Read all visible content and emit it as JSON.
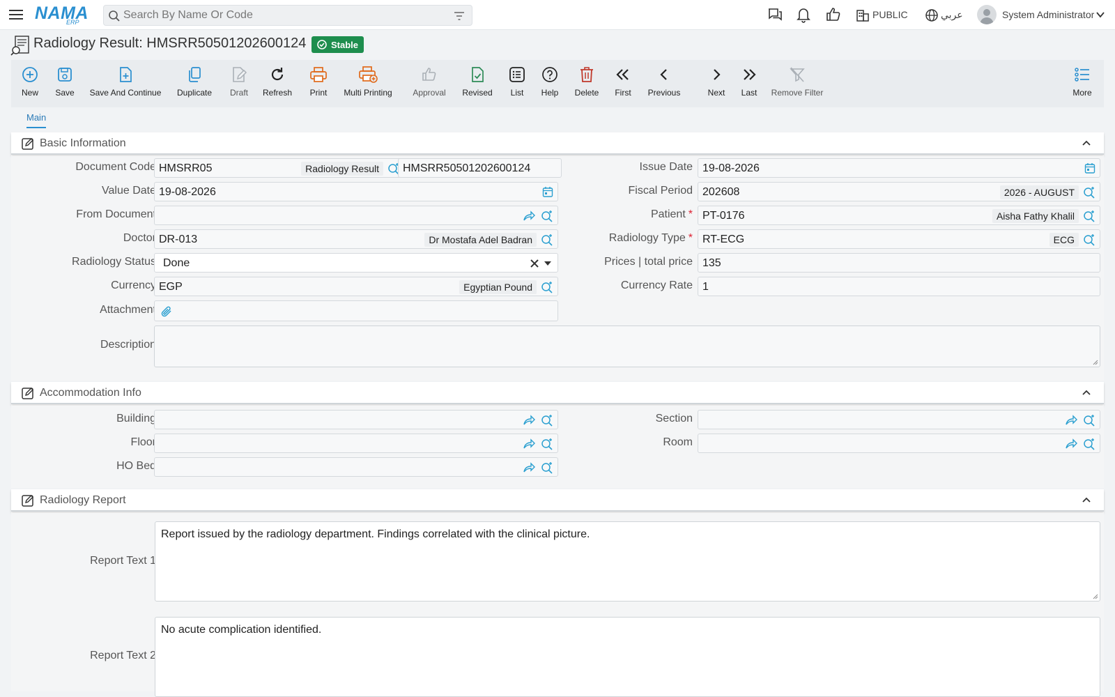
{
  "header": {
    "logo": "NAMA",
    "logo_sub": "ERP",
    "search_placeholder": "Search By Name Or Code",
    "branch": "PUBLIC",
    "language": "عربي",
    "user": "System Administrator"
  },
  "page": {
    "title": "Radiology Result: HMSRR50501202600124",
    "status": "Stable"
  },
  "toolbar": {
    "new": "New",
    "save": "Save",
    "save_continue": "Save And Continue",
    "duplicate": "Duplicate",
    "draft": "Draft",
    "refresh": "Refresh",
    "print": "Print",
    "multi_printing": "Multi Printing",
    "approval": "Approval",
    "revised": "Revised",
    "list": "List",
    "help": "Help",
    "delete": "Delete",
    "first": "First",
    "previous": "Previous",
    "next": "Next",
    "last": "Last",
    "remove_filter": "Remove Filter",
    "more": "More"
  },
  "tabs": {
    "main": "Main"
  },
  "basic": {
    "title": "Basic Information",
    "document_code": {
      "label": "Document Code",
      "value": "HMSRR05",
      "desc": "Radiology Result",
      "code": "HMSRR50501202600124"
    },
    "issue_date": {
      "label": "Issue Date",
      "value": "19-08-2026"
    },
    "value_date": {
      "label": "Value Date",
      "value": "19-08-2026"
    },
    "fiscal_period": {
      "label": "Fiscal Period",
      "value": "202608",
      "desc": "2026 - AUGUST"
    },
    "from_document": {
      "label": "From Document",
      "value": ""
    },
    "patient": {
      "label": "Patient",
      "value": "PT-0176",
      "desc": "Aisha Fathy Khalil"
    },
    "doctor": {
      "label": "Doctor",
      "value": "DR-013",
      "desc": "Dr Mostafa Adel Badran"
    },
    "radiology_type": {
      "label": "Radiology Type",
      "value": "RT-ECG",
      "desc": "ECG"
    },
    "radiology_status": {
      "label": "Radiology Status",
      "value": "Done"
    },
    "prices": {
      "label": "Prices | total price",
      "value": "135"
    },
    "currency": {
      "label": "Currency",
      "value": "EGP",
      "desc": "Egyptian Pound"
    },
    "currency_rate": {
      "label": "Currency Rate",
      "value": "1"
    },
    "attachment": {
      "label": "Attachment"
    },
    "description": {
      "label": "Description",
      "value": ""
    }
  },
  "accommodation": {
    "title": "Accommodation Info",
    "building": "Building",
    "section": "Section",
    "floor": "Floor",
    "room": "Room",
    "ho_bed": "HO Bed"
  },
  "report": {
    "title": "Radiology Report",
    "text1_label": "Report Text 1",
    "text1": "Report issued by the radiology department. Findings correlated with the clinical picture.",
    "text2_label": "Report Text 2",
    "text2": "No acute complication identified."
  },
  "colors": {
    "accent": "#2a8fd0",
    "stable": "#1e8e4e",
    "print": "#e06a1b",
    "delete": "#c0392b",
    "revised": "#2e8b57"
  }
}
